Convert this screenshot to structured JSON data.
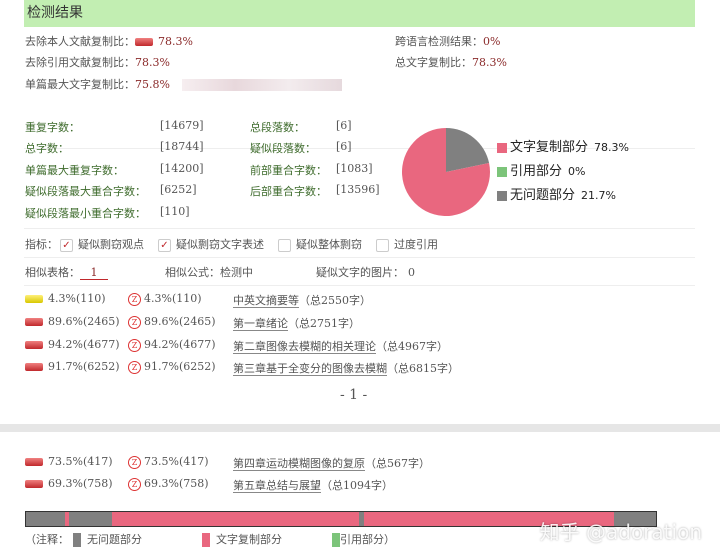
{
  "header": {
    "title": "检测结果"
  },
  "summary": {
    "self_excluded_label": "去除本人文献复制比：",
    "self_excluded_value": "78.3%",
    "cross_lang_label": "跨语言检测结果：",
    "cross_lang_value": "0%",
    "ref_excluded_label": "去除引用文献复制比：",
    "ref_excluded_value": "78.3%",
    "total_copy_label": "总文字复制比：",
    "total_copy_value": "78.3%",
    "single_max_label": "单篇最大文字复制比：",
    "single_max_value": "75.8%"
  },
  "stats": [
    {
      "label": "重复字数：",
      "value": "[14679]"
    },
    {
      "label": "总字数：",
      "value": "[18744]"
    },
    {
      "label": "单篇最大重复字数：",
      "value": "[14200]"
    },
    {
      "label": "疑似段落最大重合字数：",
      "value": "[6252]"
    },
    {
      "label": "疑似段落最小重合字数：",
      "value": "[110]"
    }
  ],
  "stats2": [
    {
      "label": "总段落数：",
      "value": "[6]"
    },
    {
      "label": "疑似段落数：",
      "value": "[6]"
    },
    {
      "label": "前部重合字数：",
      "value": "[1083]"
    },
    {
      "label": "后部重合字数：",
      "value": "[13596]"
    }
  ],
  "pie": {
    "legend": [
      {
        "label": "文字复制部分",
        "value": "78.3%",
        "pct": 78.3,
        "color": "#e9677f"
      },
      {
        "label": "引用部分",
        "value": "0%",
        "pct": 0,
        "color": "#7cc47a"
      },
      {
        "label": "无问题部分",
        "value": "21.7%",
        "pct": 21.7,
        "color": "#808080"
      }
    ]
  },
  "indicators": {
    "label": "指标：",
    "items": [
      {
        "label": "疑似剽窃观点",
        "checked": true
      },
      {
        "label": "疑似剽窃文字表述",
        "checked": true
      },
      {
        "label": "疑似整体剽窃",
        "checked": false
      },
      {
        "label": "过度引用",
        "checked": false
      }
    ]
  },
  "similar": {
    "table_label": "相似表格：",
    "table_value": "1",
    "formula_label": "相似公式：",
    "formula_value": "检测中",
    "image_label": "疑似文字的图片：",
    "image_value": "0"
  },
  "chapters": [
    {
      "pct": "4.3%(110)",
      "pct2": "4.3%(110)",
      "title": "中英文摘要等",
      "total": "（总2550字）",
      "yellow": true
    },
    {
      "pct": "89.6%(2465)",
      "pct2": "89.6%(2465)",
      "title": "第一章绪论",
      "total": "（总2751字）"
    },
    {
      "pct": "94.2%(4677)",
      "pct2": "94.2%(4677)",
      "title": "第二章图像去模糊的相关理论",
      "total": "（总4967字）"
    },
    {
      "pct": "91.7%(6252)",
      "pct2": "91.7%(6252)",
      "title": "第三章基于全变分的图像去模糊",
      "total": "（总6815字）"
    },
    {
      "pct": "73.5%(417)",
      "pct2": "73.5%(417)",
      "title": "第四章运动模糊图像的复原",
      "total": "（总567字）"
    },
    {
      "pct": "69.3%(758)",
      "pct2": "69.3%(758)",
      "title": "第五章总结与展望",
      "total": "（总1094字）"
    }
  ],
  "page_number": "- 1 -",
  "distribution": {
    "segments": [
      {
        "type": "none",
        "share": 6.2
      },
      {
        "type": "copy",
        "share": 0.6
      },
      {
        "type": "none",
        "share": 6.8
      },
      {
        "type": "copy",
        "share": 39.3
      },
      {
        "type": "none",
        "share": 0.8
      },
      {
        "type": "copy",
        "share": 39.7
      },
      {
        "type": "none",
        "share": 6.6
      }
    ]
  },
  "note": {
    "prefix": "（注释：",
    "none": "无问题部分",
    "copy": "文字复制部分",
    "ref": "引用部分）"
  },
  "watermark": "知乎 @adoration",
  "colors": {
    "none": "#808080",
    "copy": "#e9677f",
    "ref": "#7cc47a"
  }
}
